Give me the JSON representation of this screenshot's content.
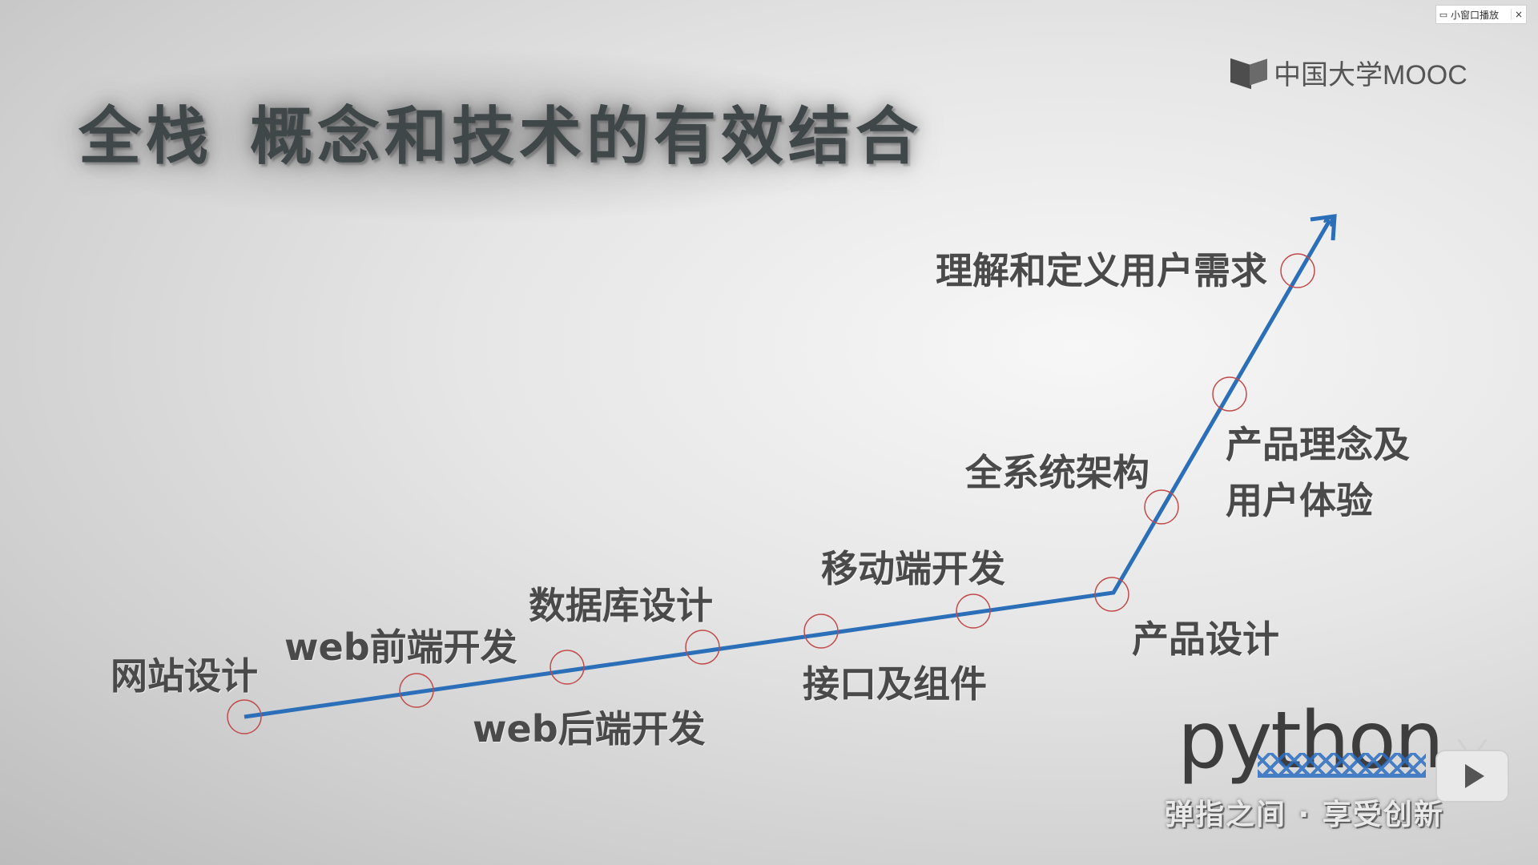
{
  "slide": {
    "title_part1": "全栈",
    "title_part2": "概念和技术的有效结合"
  },
  "brand": {
    "logo_icon": "mooc-book-icon",
    "name": "中国大学MOOC"
  },
  "mini_player": {
    "icon": "window-icon",
    "label": "小窗口播放",
    "close": "×"
  },
  "python_logo": {
    "word": "python",
    "slogan": "弹指之间 · 享受创新"
  },
  "play_button": {
    "icon": "play-icon"
  },
  "timeline": {
    "line_color": "#2a6fb8",
    "marker_color": "#c24a4a",
    "stages": [
      {
        "label": "网站设计"
      },
      {
        "label": "web前端开发"
      },
      {
        "label": "web后端开发"
      },
      {
        "label": "数据库设计"
      },
      {
        "label": "接口及组件"
      },
      {
        "label": "移动端开发"
      },
      {
        "label": "产品设计"
      },
      {
        "label": "全系统架构"
      },
      {
        "label": "产品理念及"
      },
      {
        "label": "用户体验"
      },
      {
        "label": "理解和定义用户需求"
      }
    ]
  }
}
